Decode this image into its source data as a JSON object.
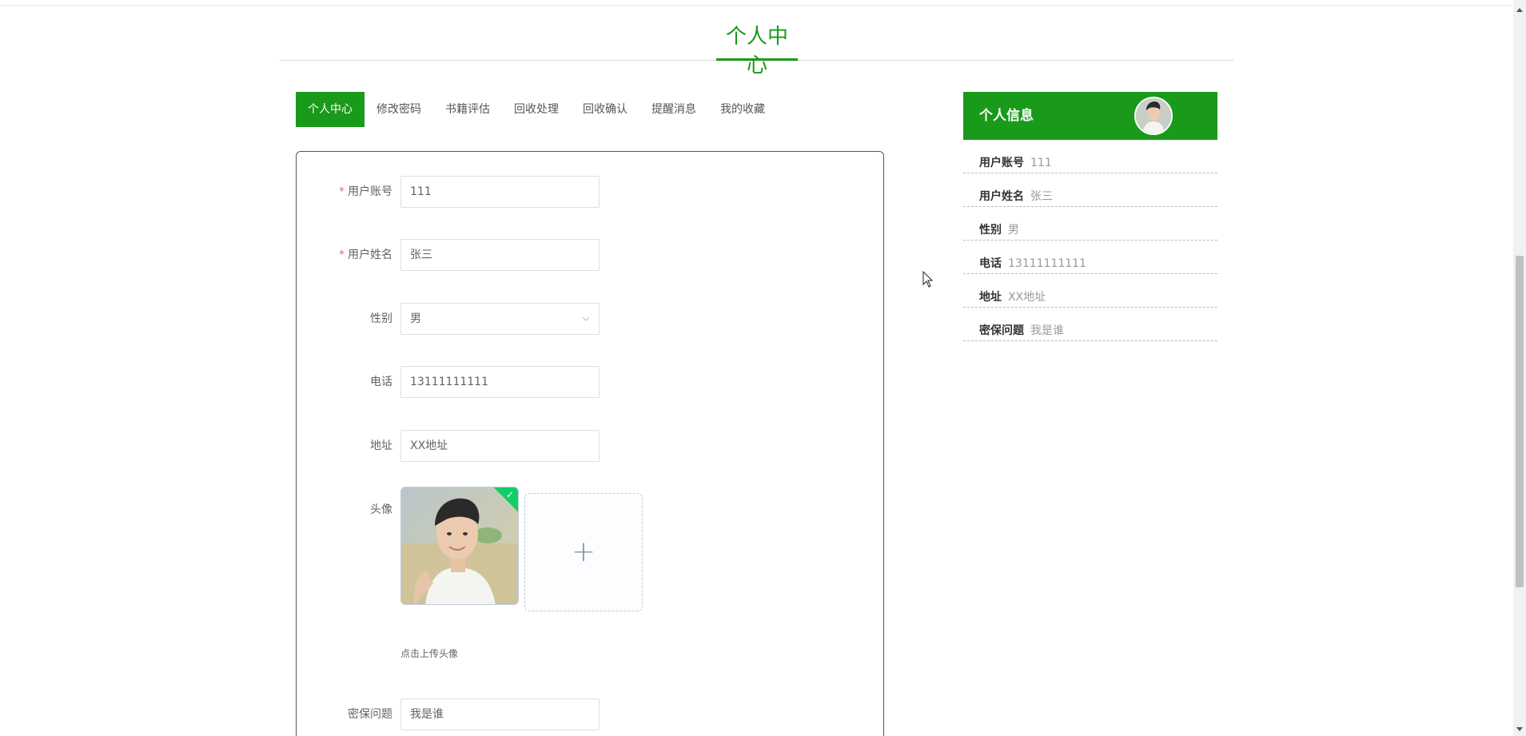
{
  "page": {
    "title": "个人中心"
  },
  "tabs": [
    {
      "label": "个人中心",
      "active": true
    },
    {
      "label": "修改密码",
      "active": false
    },
    {
      "label": "书籍评估",
      "active": false
    },
    {
      "label": "回收处理",
      "active": false
    },
    {
      "label": "回收确认",
      "active": false
    },
    {
      "label": "提醒消息",
      "active": false
    },
    {
      "label": "我的收藏",
      "active": false
    }
  ],
  "form": {
    "account": {
      "label": "用户账号",
      "required_mark": "*",
      "value": "111"
    },
    "name": {
      "label": "用户姓名",
      "required_mark": "*",
      "value": "张三"
    },
    "gender": {
      "label": "性别",
      "value": "男"
    },
    "phone": {
      "label": "电话",
      "value": "13111111111"
    },
    "address": {
      "label": "地址",
      "value": "XX地址"
    },
    "avatar": {
      "label": "头像",
      "upload_hint": "点击上传头像",
      "upload_icon": "plus-icon"
    },
    "security_question": {
      "label": "密保问题",
      "value": "我是谁"
    }
  },
  "side_panel": {
    "title": "个人信息",
    "rows": [
      {
        "key": "用户账号",
        "value": "111"
      },
      {
        "key": "用户姓名",
        "value": "张三"
      },
      {
        "key": "性别",
        "value": "男"
      },
      {
        "key": "电话",
        "value": "13111111111"
      },
      {
        "key": "地址",
        "value": "XX地址"
      },
      {
        "key": "密保问题",
        "value": "我是谁"
      }
    ]
  },
  "colors": {
    "accent": "#1a9a1a",
    "required": "#f56c6c",
    "success_badge": "#13ce66"
  }
}
